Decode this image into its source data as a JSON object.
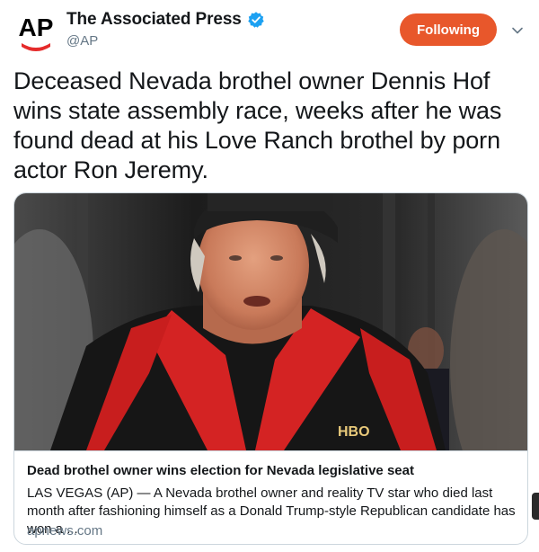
{
  "account": {
    "display_name": "The Associated Press",
    "handle": "@AP",
    "verified": true,
    "avatar_text": "AP"
  },
  "follow_button": {
    "label": "Following",
    "color": "#e8572b"
  },
  "tweet": {
    "text": "Deceased Nevada brothel owner Dennis Hof wins state assembly race, weeks after he was found dead at his Love Ranch brothel by porn actor Ron Jeremy."
  },
  "card": {
    "image_caption_shirt_text": "HBO",
    "title": "Dead brothel owner wins election for Nevada legislative seat",
    "description": "LAS VEGAS (AP) — A Nevada brothel owner and reality TV star who died last month after fashioning himself as a Donald Trump-style Republican candidate has won a ...",
    "domain": "apnews.com"
  },
  "icons": {
    "verified": "verified-badge-icon",
    "chevron": "chevron-down-icon"
  },
  "colors": {
    "accent": "#e8572b",
    "verified_blue": "#1da1f2",
    "ap_red": "#e52b2b"
  }
}
